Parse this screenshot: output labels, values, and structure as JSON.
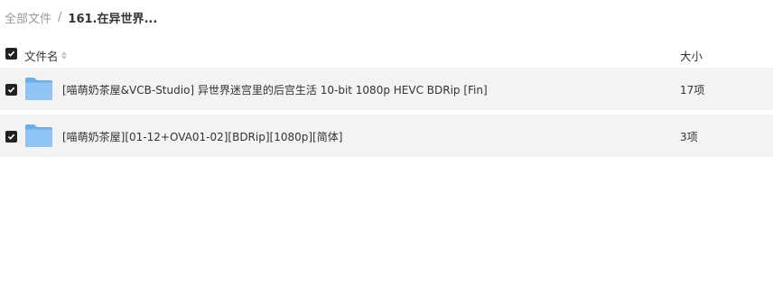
{
  "breadcrumb": {
    "root": "全部文件",
    "separator": "/",
    "current": "161.在异世界..."
  },
  "table": {
    "columns": {
      "name": "文件名",
      "size": "大小"
    },
    "rows": [
      {
        "name": "[喵萌奶茶屋&VCB-Studio] 异世界迷宫里的后宫生活 10-bit 1080p HEVC BDRip [Fin]",
        "size": "17项",
        "type": "folder",
        "checked": true
      },
      {
        "name": "[喵萌奶茶屋][01-12+OVA01-02][BDRip][1080p][简体]",
        "size": "3项",
        "type": "folder",
        "checked": true
      }
    ]
  },
  "colors": {
    "folder": "#8fc4f4",
    "checkbox": "#222222",
    "row_bg": "#f3f3f3"
  },
  "icons": {
    "folder": "folder-icon",
    "checkbox": "checkbox-checked-icon",
    "sort": "sort-icon"
  }
}
